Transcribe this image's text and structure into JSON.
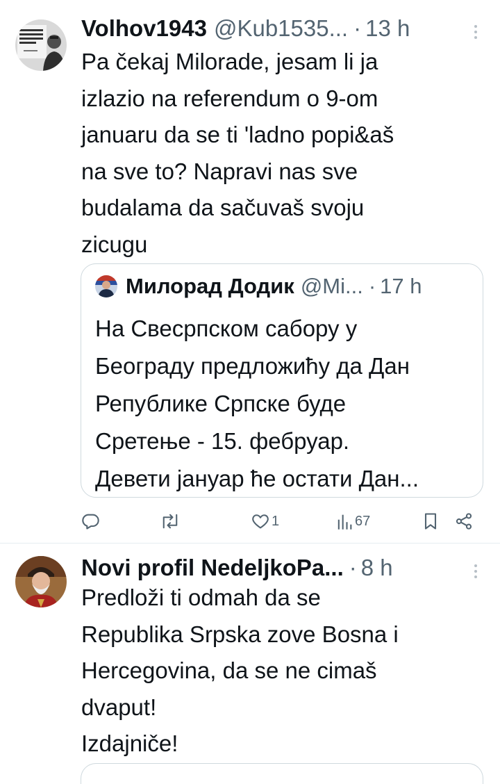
{
  "tweet1": {
    "name": "Volhov1943",
    "handle": "@Kub1535...",
    "dot": "·",
    "time": "13 h",
    "avatar_icon": "poster-with-portrait-avatar",
    "avatar_caption": "НАС НЕ МУЧИ ШТО ЈЕ МЕНТАЛ... НАШ ЈЕ ПРОБЛЕМ ОСТАНАК ИДИОТА",
    "text": "Pa čekaj Milorade, jesam li ja\nizlazio na referendum o 9-om\njanuaru da se ti 'ladno popi&aš\nna sve to? Napravi nas sve\nbudalama da sačuvaš svoju\nzicugu",
    "quote": {
      "name": "Милорад Додик",
      "handle": "@Mi...",
      "dot": "·",
      "time": "17 h",
      "text": "На Свесрпском сабору у\nБеограду предложићу да Дан\nРепублике Српске буде\nСретење - 15. фебруар.\nДевети јануар ће остати Дан..."
    },
    "actions": {
      "reply_icon": "reply-icon",
      "retweet_icon": "retweet-icon",
      "like_icon": "heart-icon",
      "like_count": "1",
      "views_icon": "views-icon",
      "views_count": "67",
      "bookmark_icon": "bookmark-icon",
      "share_icon": "share-icon"
    }
  },
  "tweet2": {
    "name": "Novi profil NedeljkoPa...",
    "dot": "·",
    "time": "8 h",
    "avatar_icon": "bearded-man-avatar",
    "text": "Predloži ti odmah da se\nRepublika Srpska zove Bosna i\nHercegovina, da se ne cimaš\ndvaput!\nIzdajniče!"
  },
  "colors": {
    "text": "#0f1419",
    "secondary": "#536471",
    "border": "#cfd9de",
    "divider": "#e6ecf0"
  }
}
